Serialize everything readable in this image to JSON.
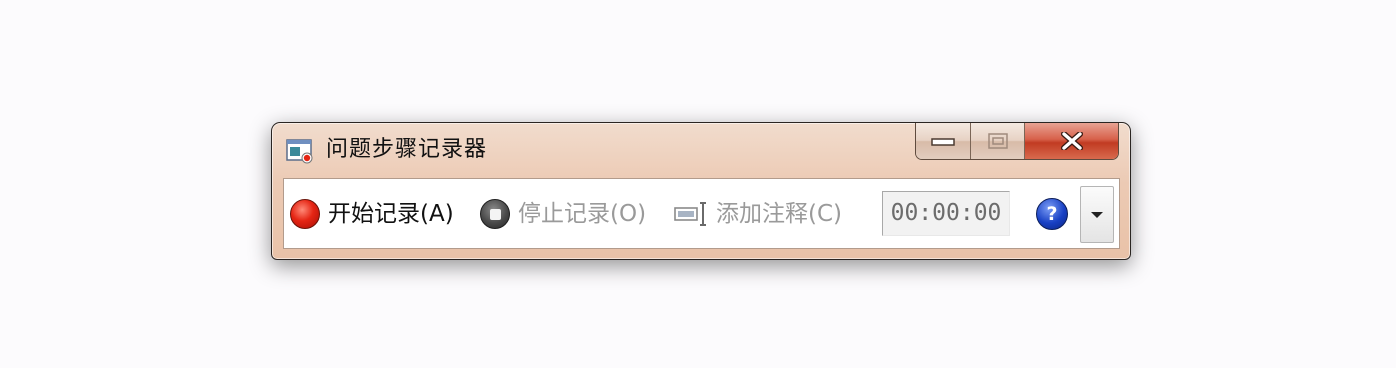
{
  "window": {
    "title": "问题步骤记录器",
    "app_icon": "steps-recorder-icon",
    "caption_buttons": {
      "minimize_icon": "minimize-icon",
      "maximize_icon": "maximize-icon",
      "close_icon": "close-icon"
    }
  },
  "toolbar": {
    "start_record": {
      "label": "开始记录(A)",
      "icon": "record-icon",
      "enabled": true
    },
    "stop_record": {
      "label": "停止记录(O)",
      "icon": "stop-icon",
      "enabled": false
    },
    "add_comment": {
      "label": "添加注释(C)",
      "icon": "comment-icon",
      "enabled": false
    },
    "timer": "00:00:00",
    "help_icon": "help-icon",
    "help_glyph": "?",
    "menu_dropdown_icon": "chevron-down-icon"
  },
  "colors": {
    "record_red": "#e52514",
    "help_blue": "#1840c4",
    "close_red": "#c13b22",
    "disabled_text": "#9a9a9a"
  }
}
